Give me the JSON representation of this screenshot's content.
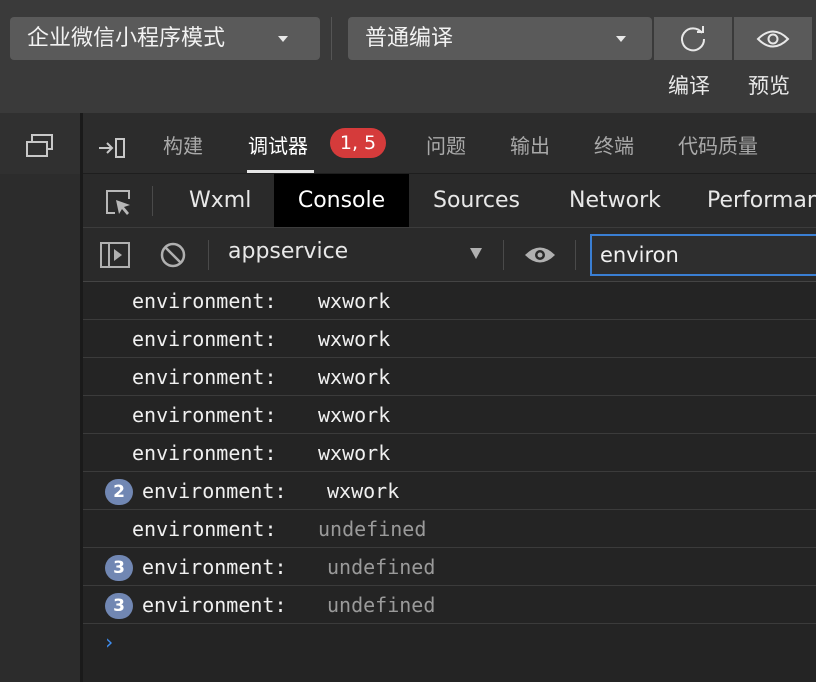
{
  "toolbar": {
    "mode_select": "企业微信小程序模式",
    "compile_select": "普通编译",
    "compile_label": "编译",
    "preview_label": "预览"
  },
  "main_tabs": [
    {
      "label": "构建"
    },
    {
      "label": "调试器"
    },
    {
      "label": "问题"
    },
    {
      "label": "输出"
    },
    {
      "label": "终端"
    },
    {
      "label": "代码质量"
    }
  ],
  "badge": "1, 5",
  "devtools_tabs": [
    {
      "label": "Wxml"
    },
    {
      "label": "Console"
    },
    {
      "label": "Sources"
    },
    {
      "label": "Network"
    },
    {
      "label": "Performan"
    }
  ],
  "console_filter": {
    "context": "appservice",
    "filter_value": "environ"
  },
  "logs": [
    {
      "count": "",
      "key": "environment:",
      "value": "wxwork"
    },
    {
      "count": "",
      "key": "environment:",
      "value": "wxwork"
    },
    {
      "count": "",
      "key": "environment:",
      "value": "wxwork"
    },
    {
      "count": "",
      "key": "environment:",
      "value": "wxwork"
    },
    {
      "count": "",
      "key": "environment:",
      "value": "wxwork"
    },
    {
      "count": "2",
      "key": "environment:",
      "value": "wxwork"
    },
    {
      "count": "",
      "key": "environment:",
      "value": "undefined"
    },
    {
      "count": "3",
      "key": "environment:",
      "value": "undefined"
    },
    {
      "count": "3",
      "key": "environment:",
      "value": "undefined"
    }
  ],
  "prompt": "›",
  "colors": {
    "accent": "#3a7fd4",
    "badge": "#d53b3b",
    "count_bubble": "#7187b3"
  }
}
